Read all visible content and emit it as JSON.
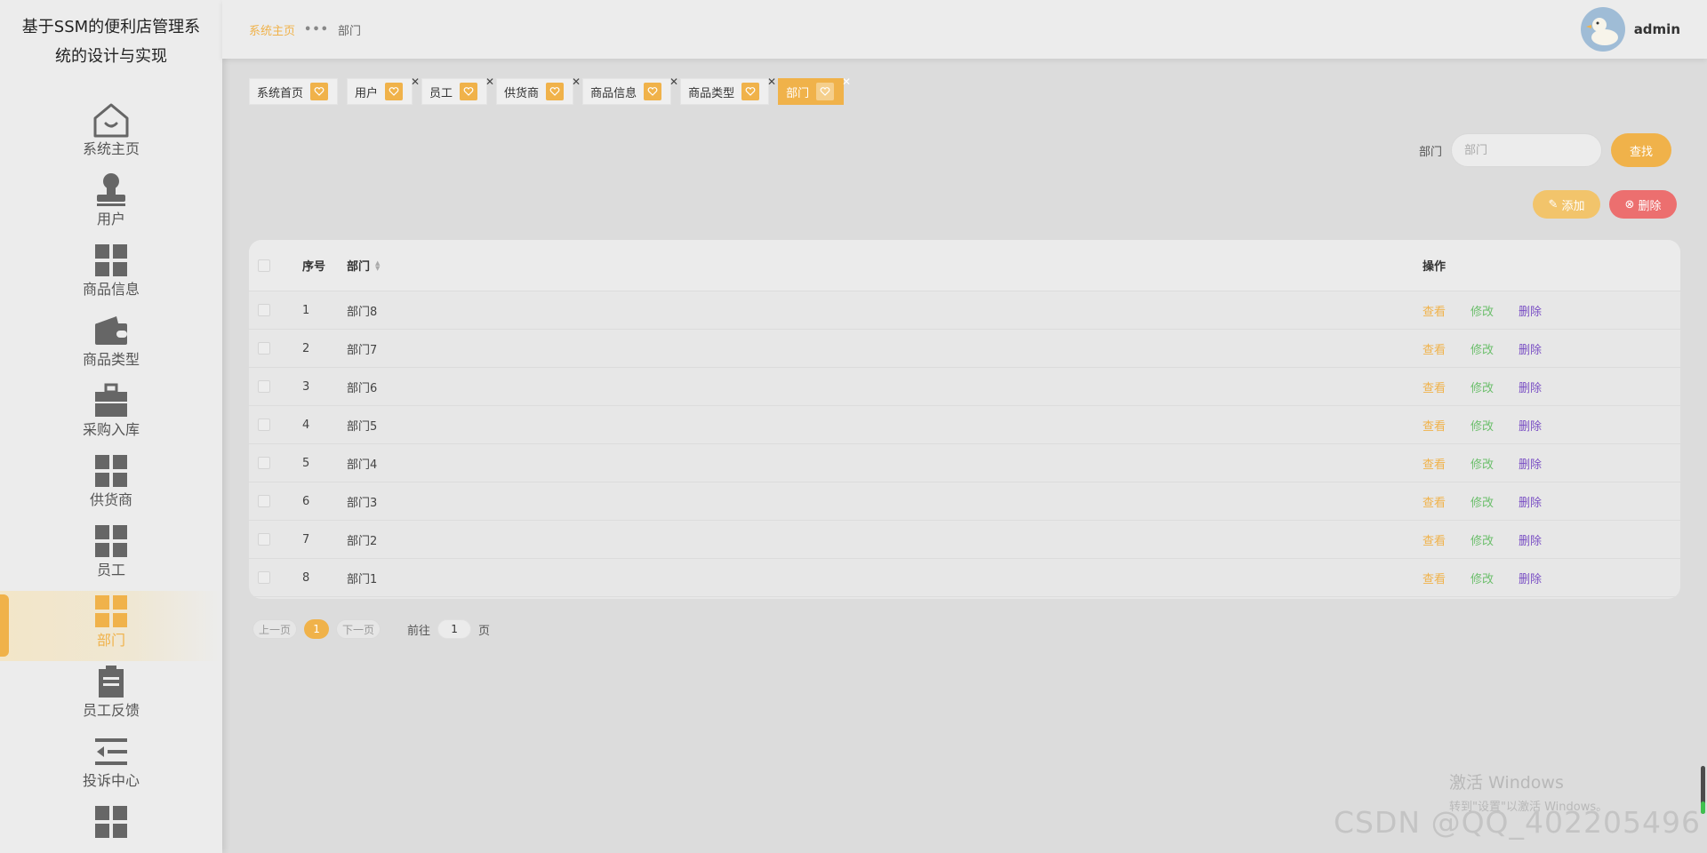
{
  "app": {
    "title": "基于SSM的便利店管理系统的设计与实现"
  },
  "sidebar": {
    "items": [
      {
        "label": "系统主页",
        "icon": "home-icon"
      },
      {
        "label": "用户",
        "icon": "user-icon"
      },
      {
        "label": "商品信息",
        "icon": "grid-icon"
      },
      {
        "label": "商品类型",
        "icon": "wallet-icon"
      },
      {
        "label": "采购入库",
        "icon": "briefcase-icon"
      },
      {
        "label": "供货商",
        "icon": "grid-icon"
      },
      {
        "label": "员工",
        "icon": "grid-icon"
      },
      {
        "label": "部门",
        "icon": "grid-icon",
        "active": true
      },
      {
        "label": "员工反馈",
        "icon": "clipboard-icon"
      },
      {
        "label": "投诉中心",
        "icon": "list-icon"
      },
      {
        "label": "",
        "icon": "grid-icon"
      }
    ]
  },
  "header": {
    "breadcrumb_home": "系统主页",
    "breadcrumb_sep": "•••",
    "breadcrumb_current": "部门",
    "username": "admin"
  },
  "tags": [
    {
      "label": "系统首页",
      "closable": false
    },
    {
      "label": "用户",
      "closable": true
    },
    {
      "label": "员工",
      "closable": true
    },
    {
      "label": "供货商",
      "closable": true
    },
    {
      "label": "商品信息",
      "closable": true
    },
    {
      "label": "商品类型",
      "closable": true
    },
    {
      "label": "部门",
      "closable": true,
      "active": true
    }
  ],
  "search": {
    "label": "部门",
    "placeholder": "部门",
    "value": "",
    "button": "查找"
  },
  "actions": {
    "add": "添加",
    "delete": "删除"
  },
  "table": {
    "headers": {
      "index": "序号",
      "name": "部门",
      "ops": "操作"
    },
    "ops": {
      "view": "查看",
      "edit": "修改",
      "delete": "删除"
    },
    "rows": [
      {
        "index": "1",
        "name": "部门8"
      },
      {
        "index": "2",
        "name": "部门7"
      },
      {
        "index": "3",
        "name": "部门6"
      },
      {
        "index": "4",
        "name": "部门5"
      },
      {
        "index": "5",
        "name": "部门4"
      },
      {
        "index": "6",
        "name": "部门3"
      },
      {
        "index": "7",
        "name": "部门2"
      },
      {
        "index": "8",
        "name": "部门1"
      }
    ]
  },
  "pagination": {
    "prev": "上一页",
    "current": "1",
    "next": "下一页",
    "goto": "前往",
    "page_value": "1",
    "page_unit": "页"
  },
  "watermark": {
    "line1": "激活 Windows",
    "line2": "转到\"设置\"以激活 Windows。",
    "csdn": "CSDN @QQ_402205496"
  },
  "colors": {
    "accent": "#f0b24a",
    "danger": "#ec6f6f",
    "edit": "#6cbf6c",
    "delete_link": "#7a4fc4"
  }
}
